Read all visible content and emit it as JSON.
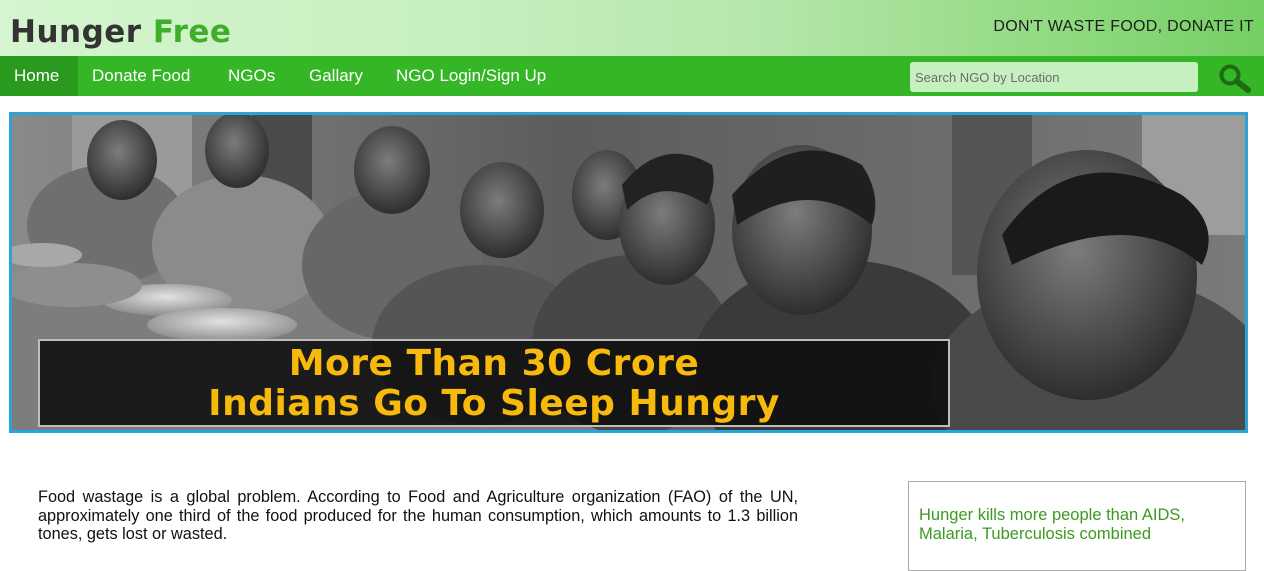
{
  "header": {
    "brand_first": "Hunger",
    "brand_second": "Free",
    "tagline": "DON'T WASTE FOOD, DONATE IT"
  },
  "nav": {
    "items": [
      {
        "label": "Home",
        "active": true
      },
      {
        "label": "Donate Food"
      },
      {
        "label": "NGOs"
      },
      {
        "label": "Gallary"
      },
      {
        "label": "NGO Login/Sign Up"
      }
    ]
  },
  "search": {
    "placeholder": "Search NGO by Location",
    "icon": "magnifier-icon"
  },
  "banner": {
    "caption_line1": "More Than 30 Crore",
    "caption_line2": "Indians Go To Sleep Hungry",
    "caption_color": "#f6b90c",
    "border_color": "#2aa4d8"
  },
  "content": {
    "intro": "Food wastage is a global problem. According to Food and Agriculture organization (FAO) of the UN, approximately one third of the food produced for the human consumption, which amounts to 1.3 billion tones, gets lost or wasted.",
    "fact": "Hunger kills more people than AIDS, Malaria, Tuberculosis combined"
  },
  "colors": {
    "nav_bg": "#34b626",
    "nav_active": "#2a9a1e",
    "brand_accent": "#3fae2a",
    "fact_text": "#3d9a22"
  }
}
